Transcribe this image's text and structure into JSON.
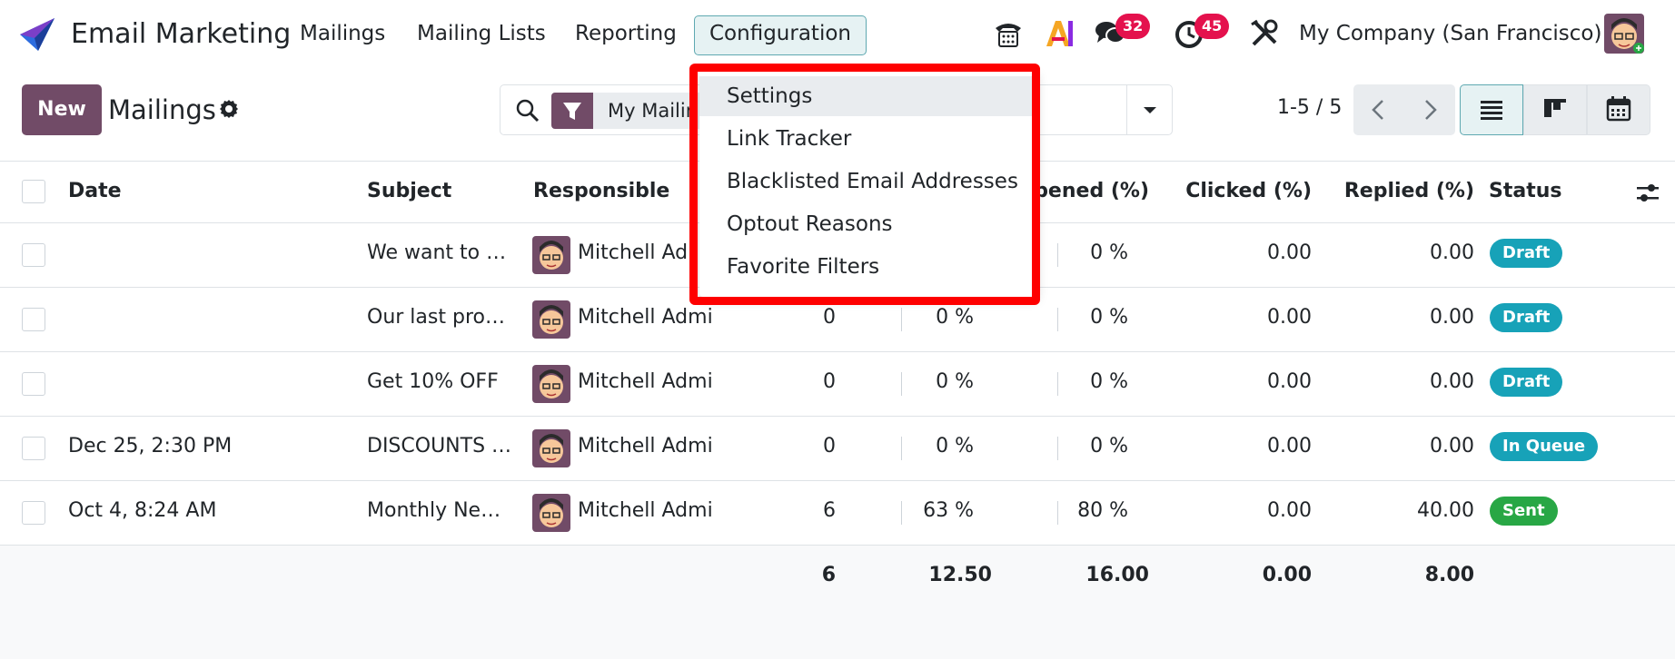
{
  "navbar": {
    "app_title": "Email Marketing",
    "menu": [
      "Mailings",
      "Mailing Lists",
      "Reporting",
      "Configuration"
    ],
    "messages_badge": "32",
    "activities_badge": "45",
    "company": "My Company (San Francisco)"
  },
  "control": {
    "new_label": "New",
    "title": "Mailings",
    "facet_label": "My Mailin",
    "pager": "1-5 / 5"
  },
  "table": {
    "headers": {
      "date": "Date",
      "subject": "Subject",
      "responsible": "Responsible",
      "opened": "pened (%)",
      "clicked": "Clicked (%)",
      "replied": "Replied (%)",
      "status": "Status"
    },
    "rows": [
      {
        "date": "",
        "subject": "We want to …",
        "responsible": "Mitchell Ad",
        "sent": "",
        "delivered": "",
        "opened": "0 %",
        "clicked": "0.00",
        "replied": "0.00",
        "status": "Draft"
      },
      {
        "date": "",
        "subject": "Our last pro…",
        "responsible": "Mitchell Admi",
        "sent": "0",
        "delivered": "0 %",
        "opened": "0 %",
        "clicked": "0.00",
        "replied": "0.00",
        "status": "Draft"
      },
      {
        "date": "",
        "subject": "Get 10% OFF",
        "responsible": "Mitchell Admi",
        "sent": "0",
        "delivered": "0 %",
        "opened": "0 %",
        "clicked": "0.00",
        "replied": "0.00",
        "status": "Draft"
      },
      {
        "date": "Dec 25, 2:30 PM",
        "subject": "DISCOUNTS …",
        "responsible": "Mitchell Admi",
        "sent": "0",
        "delivered": "0 %",
        "opened": "0 %",
        "clicked": "0.00",
        "replied": "0.00",
        "status": "In Queue"
      },
      {
        "date": "Oct 4, 8:24 AM",
        "subject": "Monthly Ne…",
        "responsible": "Mitchell Admi",
        "sent": "6",
        "delivered": "63 %",
        "opened": "80 %",
        "clicked": "0.00",
        "replied": "40.00",
        "status": "Sent"
      }
    ],
    "totals": {
      "sent": "6",
      "delivered": "12.50",
      "opened": "16.00",
      "clicked": "0.00",
      "replied": "8.00"
    }
  },
  "dropdown": {
    "items": [
      "Settings",
      "Link Tracker",
      "Blacklisted Email Addresses",
      "Optout Reasons",
      "Favorite Filters"
    ]
  },
  "colors": {
    "brand": "#714b67",
    "badge": "#e4114d",
    "draft": "#17a2b8",
    "sent": "#28a745",
    "highlight": "#fe0000"
  }
}
